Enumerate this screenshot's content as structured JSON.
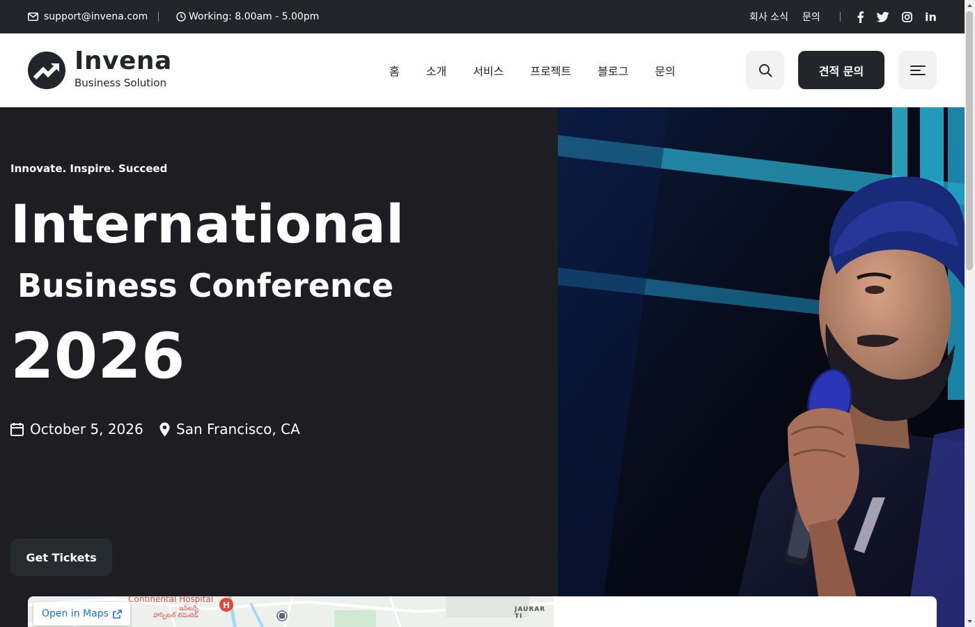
{
  "topbar": {
    "email": "support@invena.com",
    "hours": "Working: 8.00am - 5.00pm",
    "links": [
      {
        "label": "회사 소식"
      },
      {
        "label": "문의"
      }
    ],
    "social": [
      "facebook-icon",
      "twitter-icon",
      "instagram-icon",
      "linkedin-icon"
    ],
    "linkedin_label": "in"
  },
  "header": {
    "brand": "Invena",
    "brand_sub": "Business Solution",
    "nav": [
      {
        "label": "홈"
      },
      {
        "label": "소개"
      },
      {
        "label": "서비스"
      },
      {
        "label": "프로젝트"
      },
      {
        "label": "블로그"
      },
      {
        "label": "문의"
      }
    ],
    "quote_button": "견적 문의"
  },
  "hero": {
    "tagline": "Innovate. Inspire. Succeed",
    "title_line1": "International",
    "title_line2": "Business Conference",
    "title_line3": "2026",
    "date": "October 5, 2026",
    "location": "San Francisco, CA",
    "cta": "Get Tickets"
  },
  "map": {
    "open_label": "Open in Maps",
    "hospital": "Continental Hospital",
    "hospital_sub_1": "ఇన్‌టర్నే",
    "hospital_sub_2": "హాస్పిటల్ లిమిటెడ్",
    "area_label": "JAURAR TI"
  },
  "colors": {
    "dark": "#22262b",
    "hero_bg": "#1e1d22",
    "link_blue": "#1a73e8"
  }
}
